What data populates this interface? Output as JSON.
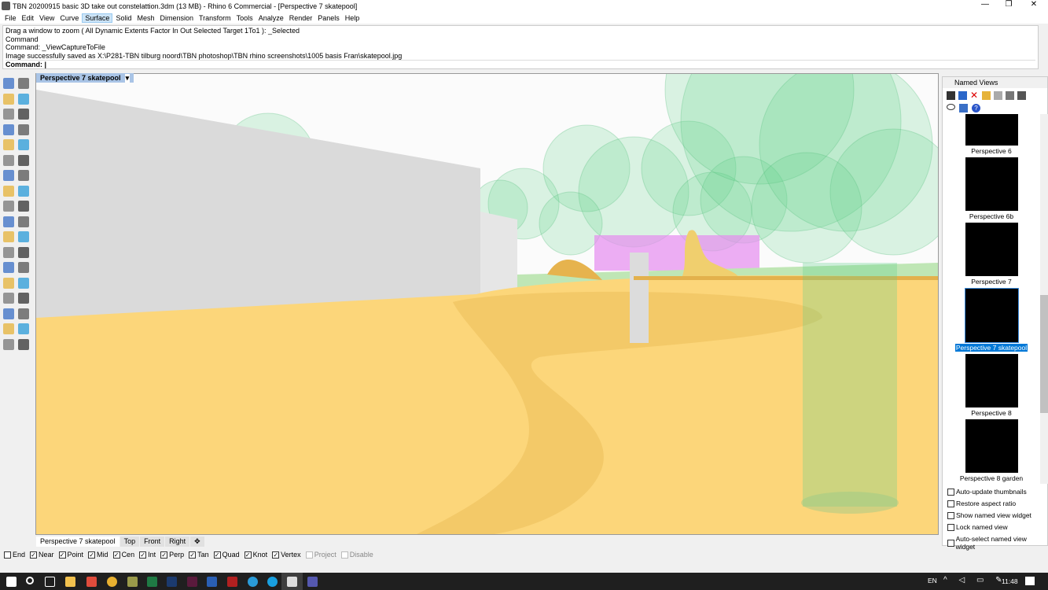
{
  "window": {
    "title": "TBN 20200915 basic 3D take out constelattion.3dm (13 MB) - Rhino 6 Commercial - [Perspective 7 skatepool]",
    "minimize": "—",
    "maximize": "❐",
    "close": "✕"
  },
  "menu": [
    "File",
    "Edit",
    "View",
    "Curve",
    "Surface",
    "Solid",
    "Mesh",
    "Dimension",
    "Transform",
    "Tools",
    "Analyze",
    "Render",
    "Panels",
    "Help"
  ],
  "command_history": [
    "Drag a window to zoom ( All  Dynamic  Extents  Factor  In  Out  Selected  Target  1To1 ): _Selected",
    "Command",
    "Command: _ViewCaptureToFile",
    "Image successfully saved as X:\\P281-TBN tilburg noord\\TBN photoshop\\TBN rhino screenshots\\1005 basis Fran\\skatepool.jpg"
  ],
  "command_prompt": "Command:",
  "viewport": {
    "title": "Perspective 7 skatepool",
    "menu_arrow": "▾"
  },
  "viewport_tabs": [
    "Perspective 7 skatepool",
    "Top",
    "Front",
    "Right",
    "✥"
  ],
  "osnaps": [
    {
      "label": "End",
      "checked": false
    },
    {
      "label": "Near",
      "checked": true
    },
    {
      "label": "Point",
      "checked": true
    },
    {
      "label": "Mid",
      "checked": true
    },
    {
      "label": "Cen",
      "checked": true
    },
    {
      "label": "Int",
      "checked": true
    },
    {
      "label": "Perp",
      "checked": true
    },
    {
      "label": "Tan",
      "checked": true
    },
    {
      "label": "Quad",
      "checked": true
    },
    {
      "label": "Knot",
      "checked": true
    },
    {
      "label": "Vertex",
      "checked": true
    },
    {
      "label": "Project",
      "checked": false,
      "disabled": true
    },
    {
      "label": "Disable",
      "checked": false,
      "disabled": true
    }
  ],
  "named_views": {
    "title": "Named Views",
    "items": [
      "Perspective 6",
      "Perspective 6b",
      "Perspective 7",
      "Perspective 7 skatepool",
      "Perspective 8",
      "Perspective 8 garden"
    ],
    "selected": "Perspective 7 skatepool",
    "options": [
      "Auto-update thumbnails",
      "Restore aspect ratio",
      "Show named view widget",
      "Lock named view",
      "Auto-select named view widget"
    ]
  },
  "taskbar": {
    "lang": "EN",
    "time": "11:48"
  },
  "colors": {
    "accent": "#0078d7",
    "ground": "#fcd67a",
    "tree": "#5fd08a"
  }
}
